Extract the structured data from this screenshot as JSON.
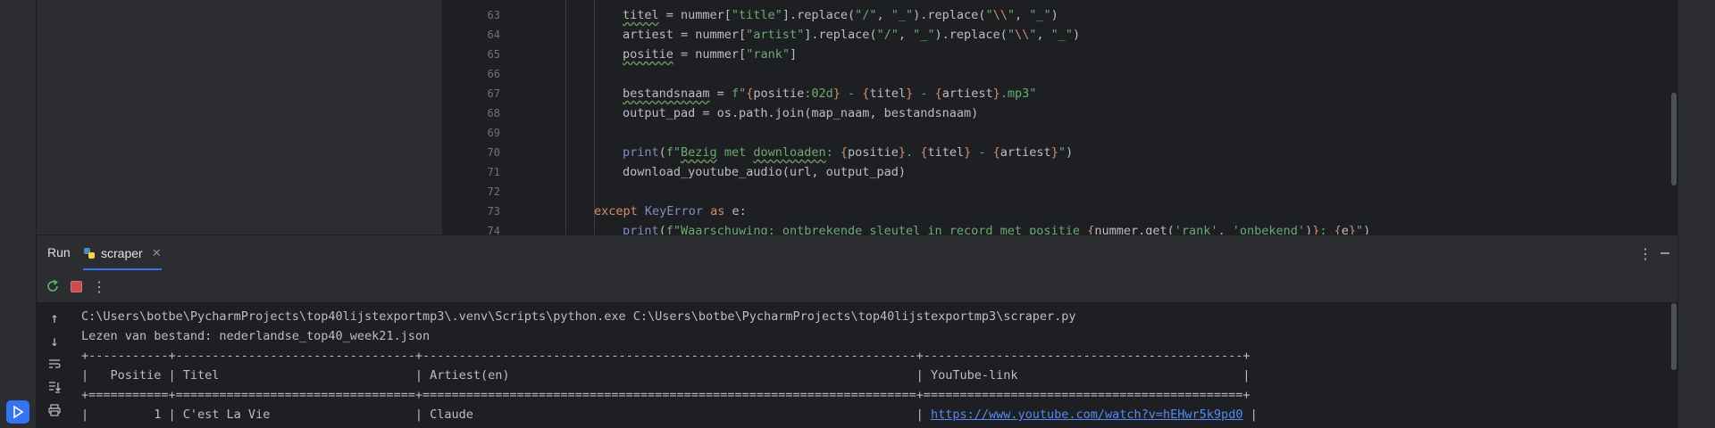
{
  "editor": {
    "lines": [
      {
        "n": "63",
        "indent": 3,
        "html": "<span class=\"typo\">titel</span> = nummer[<span class=\"str\">\"title\"</span>].replace(<span class=\"str\">\"/\"</span>, <span class=\"str\">\"_\"</span>).replace(<span class=\"str\">\"<span class=\"esc\">\\\\</span>\"</span>, <span class=\"str\">\"_\"</span>)"
      },
      {
        "n": "64",
        "indent": 3,
        "html": "artiest = nummer[<span class=\"str\">\"artist\"</span>].replace(<span class=\"str\">\"/\"</span>, <span class=\"str\">\"_\"</span>).replace(<span class=\"str\">\"<span class=\"esc\">\\\\</span>\"</span>, <span class=\"str\">\"_\"</span>)"
      },
      {
        "n": "65",
        "indent": 3,
        "html": "<span class=\"typo\">positie</span> = nummer[<span class=\"str\">\"rank\"</span>]"
      },
      {
        "n": "66",
        "indent": 3,
        "html": ""
      },
      {
        "n": "67",
        "indent": 3,
        "html": "<span class=\"typo\">bestandsnaam</span> = <span class=\"str\">f\"</span><span class=\"esc\">{</span>positie<span class=\"str\">:02d</span><span class=\"esc\">}</span><span class=\"str\"> - </span><span class=\"esc\">{</span>titel<span class=\"esc\">}</span><span class=\"str\"> - </span><span class=\"esc\">{</span>artiest<span class=\"esc\">}</span><span class=\"str\">.mp3\"</span>"
      },
      {
        "n": "68",
        "indent": 3,
        "html": "output_pad = os.path.join(map_naam, bestandsnaam)"
      },
      {
        "n": "69",
        "indent": 3,
        "html": ""
      },
      {
        "n": "70",
        "indent": 3,
        "html": "<span class=\"bi\">print</span>(<span class=\"str\">f\"<span class=\"typo\">Bezig</span> met <span class=\"typo\">downloaden</span>: </span><span class=\"esc\">{</span>positie<span class=\"esc\">}</span><span class=\"str\">. </span><span class=\"esc\">{</span>titel<span class=\"esc\">}</span><span class=\"str\"> - </span><span class=\"esc\">{</span>artiest<span class=\"esc\">}</span><span class=\"str\">\"</span>)"
      },
      {
        "n": "71",
        "indent": 3,
        "html": "download_youtube_audio(url, output_pad)"
      },
      {
        "n": "72",
        "indent": 3,
        "html": ""
      },
      {
        "n": "73",
        "indent": 2,
        "html": "<span class=\"kw\">except</span> <span class=\"bi\">KeyError</span> <span class=\"kw\">as</span> e:"
      },
      {
        "n": "74",
        "indent": 3,
        "html": "<span class=\"bi\">print</span>(<span class=\"str\">f\"Waarschuwing: ontbrekende sleutel in record met positie </span><span class=\"esc\">{</span>nummer.get(<span class=\"str\">'rank'</span>, <span class=\"str\">'onbekend'</span>)<span class=\"esc\">}</span><span class=\"str\">: </span><span class=\"esc\">{</span>e<span class=\"esc\">}</span><span class=\"str\">\"</span>)"
      }
    ]
  },
  "run_panel": {
    "title": "Run",
    "tab_label": "scraper"
  },
  "console": {
    "lines": [
      {
        "text": "C:\\Users\\botbe\\PycharmProjects\\top40lijstexportmp3\\.venv\\Scripts\\python.exe C:\\Users\\botbe\\PycharmProjects\\top40lijstexportmp3\\scraper.py"
      },
      {
        "text": "Lezen van bestand: nederlandse_top40_week21.json"
      },
      {
        "text": "+-----------+---------------------------------+--------------------------------------------------------------------+--------------------------------------------+"
      },
      {
        "text": "|   Positie | Titel                           | Artiest(en)                                                        | YouTube-link                               |"
      },
      {
        "text": "+===========+=================================+====================================================================+============================================+"
      },
      {
        "text": "|         1 | C'est La Vie                    | Claude                                                             | ",
        "link": "https://www.youtube.com/watch?v=hEHwr5k9pd0",
        "after": " |"
      }
    ]
  },
  "colors": {
    "accent": "#3574f0",
    "stop": "#c94f4f",
    "link": "#548af7"
  }
}
